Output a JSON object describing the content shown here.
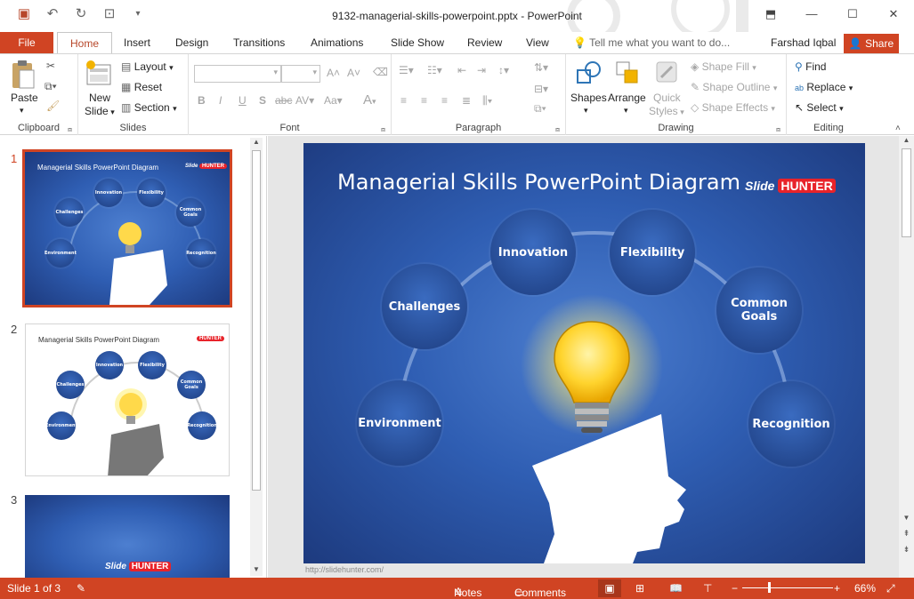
{
  "window": {
    "title": "9132-managerial-skills-powerpoint.pptx - PowerPoint"
  },
  "tabs": {
    "file": "File",
    "items": [
      "Home",
      "Insert",
      "Design",
      "Transitions",
      "Animations",
      "Slide Show",
      "Review",
      "View"
    ],
    "active": "Home",
    "tell_me": "Tell me what you want to do...",
    "user": "Farshad Iqbal",
    "share": "Share"
  },
  "ribbon": {
    "clipboard": {
      "label": "Clipboard",
      "paste": "Paste"
    },
    "slides": {
      "label": "Slides",
      "new_slide_1": "New",
      "new_slide_2": "Slide",
      "layout": "Layout",
      "reset": "Reset",
      "section": "Section"
    },
    "font": {
      "label": "Font"
    },
    "paragraph": {
      "label": "Paragraph"
    },
    "drawing": {
      "label": "Drawing",
      "shapes": "Shapes",
      "arrange": "Arrange",
      "quick_styles_1": "Quick",
      "quick_styles_2": "Styles",
      "shape_fill": "Shape Fill",
      "shape_outline": "Shape Outline",
      "shape_effects": "Shape Effects"
    },
    "editing": {
      "label": "Editing",
      "find": "Find",
      "replace": "Replace",
      "select": "Select"
    }
  },
  "thumbnails": [
    {
      "num": "1",
      "title": "Managerial Skills PowerPoint Diagram",
      "nodes": [
        "Innovation",
        "Flexibility",
        "Challenges",
        "Common Goals",
        "Environment",
        "Recognition"
      ]
    },
    {
      "num": "2",
      "title": "Managerial Skills PowerPoint Diagram",
      "nodes": [
        "Innovation",
        "Flexibility",
        "Challenges",
        "Common Goals",
        "Environment",
        "Recognition"
      ]
    },
    {
      "num": "3"
    }
  ],
  "slide": {
    "title": "Managerial Skills PowerPoint Diagram",
    "logo_slide": "Slide",
    "logo_hunter": "HUNTER",
    "nodes": {
      "innovation": "Innovation",
      "flexibility": "Flexibility",
      "challenges": "Challenges",
      "common_goals_1": "Common",
      "common_goals_2": "Goals",
      "environment": "Environment",
      "recognition": "Recognition"
    },
    "url": "http://slidehunter.com/"
  },
  "status": {
    "slide_info": "Slide 1 of 3",
    "notes": "Notes",
    "comments": "Comments",
    "zoom": "66%"
  },
  "colors": {
    "accent": "#d04423",
    "slide_bg": "#2f5eb3",
    "node": "#24488f"
  }
}
